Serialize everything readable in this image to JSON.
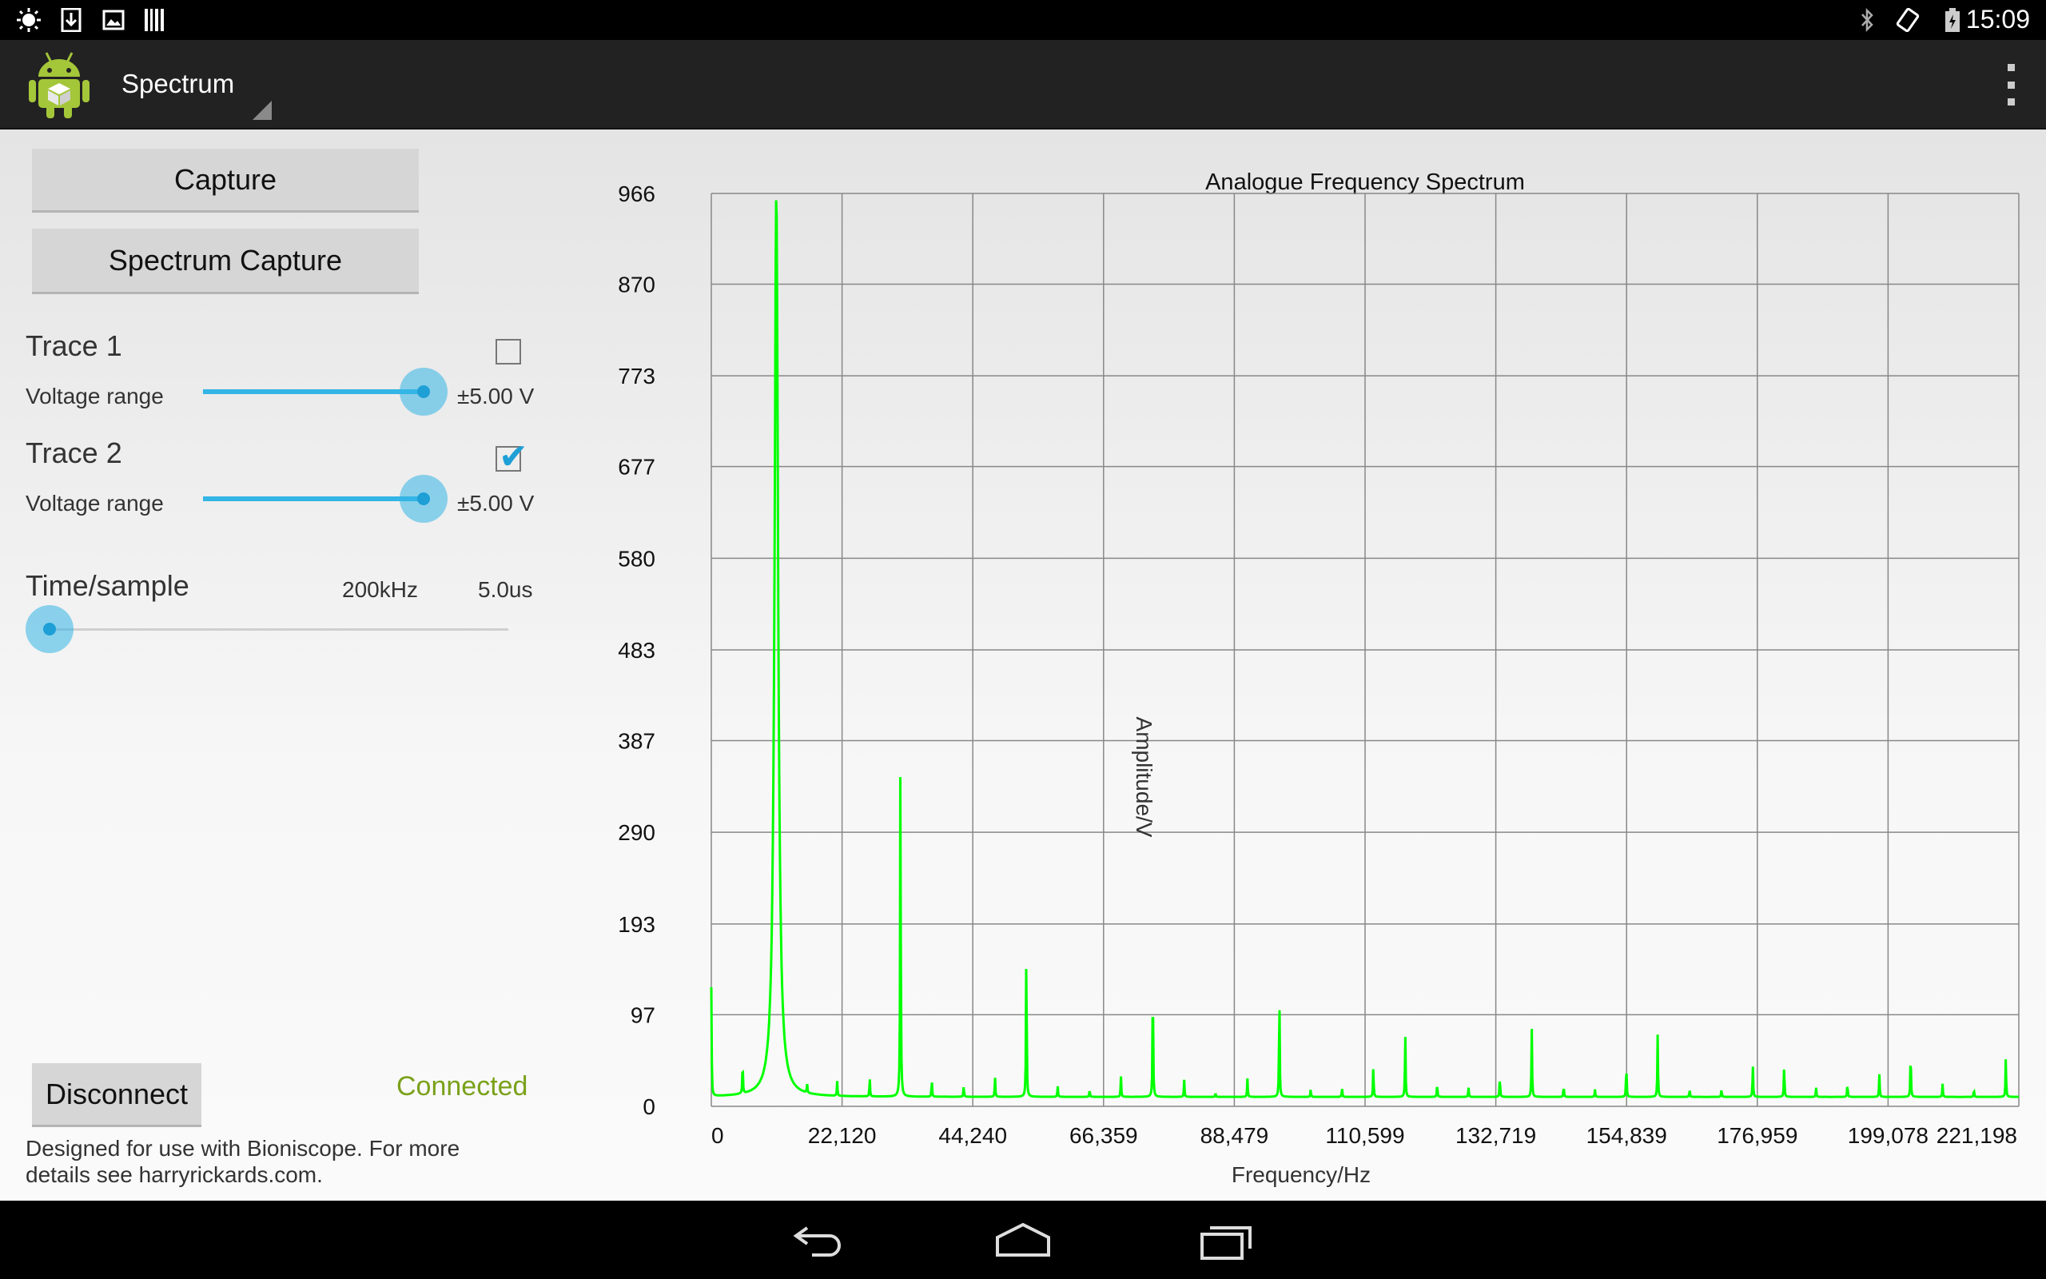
{
  "status_bar": {
    "time": "15:09",
    "left_icons": [
      "brightness-icon",
      "download-icon",
      "image-icon",
      "barcode-icon"
    ],
    "right_icons": [
      "bluetooth-icon",
      "rotation-icon",
      "battery-icon"
    ]
  },
  "action_bar": {
    "title": "Spectrum",
    "app_icon": "android-robot-icon",
    "overflow_icon": "overflow-menu-icon"
  },
  "controls": {
    "capture_label": "Capture",
    "spectrum_capture_label": "Spectrum Capture",
    "trace1": {
      "label": "Trace 1",
      "checked": false,
      "voltage_label": "Voltage range",
      "voltage_value": "±5.00 V",
      "slider_fraction": 1.0
    },
    "trace2": {
      "label": "Trace 2",
      "checked": true,
      "voltage_label": "Voltage range",
      "voltage_value": "±5.00 V",
      "slider_fraction": 1.0
    },
    "time_sample": {
      "label": "Time/sample",
      "rate": "200kHz",
      "period": "5.0us",
      "slider_fraction": 0.0
    },
    "disconnect_label": "Disconnect",
    "connection_status": "Connected",
    "footer": "Designed for use with Bioniscope. For more details see harryrickards.com."
  },
  "colors": {
    "accent": "#33b5e5",
    "trace": "#00ff00",
    "connected": "#7aa11a",
    "action_bar": "#222222"
  },
  "chart_data": {
    "type": "line",
    "title": "Analogue Frequency Spectrum",
    "xlabel": "Frequency/Hz",
    "ylabel": "Amplitude/V",
    "xlim": [
      0,
      221198
    ],
    "ylim": [
      0,
      966
    ],
    "grid": true,
    "x_ticks": [
      0,
      22120,
      44240,
      66359,
      88479,
      110599,
      132719,
      154839,
      176959,
      199078,
      221198
    ],
    "x_tick_labels": [
      "0",
      "22,120",
      "44,240",
      "66,359",
      "88,479",
      "110,599",
      "132,719",
      "154,839",
      "176,959",
      "199,078",
      "221,198"
    ],
    "y_ticks": [
      0,
      97,
      193,
      290,
      387,
      483,
      580,
      677,
      773,
      870,
      966
    ],
    "y_tick_labels": [
      "0",
      "97",
      "193",
      "290",
      "387",
      "483",
      "580",
      "677",
      "773",
      "870",
      "966"
    ],
    "series": [
      {
        "color": "#00ff00",
        "baseline": 10,
        "peaks": [
          {
            "x": 0,
            "y": 125
          },
          {
            "x": 5300,
            "y": 45
          },
          {
            "x": 11000,
            "y": 966
          },
          {
            "x": 16200,
            "y": 20
          },
          {
            "x": 21300,
            "y": 26
          },
          {
            "x": 26800,
            "y": 30
          },
          {
            "x": 32000,
            "y": 380
          },
          {
            "x": 37300,
            "y": 28
          },
          {
            "x": 42700,
            "y": 22
          },
          {
            "x": 48000,
            "y": 32
          },
          {
            "x": 53300,
            "y": 175
          },
          {
            "x": 58600,
            "y": 22
          },
          {
            "x": 64000,
            "y": 18
          },
          {
            "x": 69300,
            "y": 32
          },
          {
            "x": 74700,
            "y": 143
          },
          {
            "x": 80000,
            "y": 28
          },
          {
            "x": 85300,
            "y": 14
          },
          {
            "x": 90700,
            "y": 30
          },
          {
            "x": 96100,
            "y": 123
          },
          {
            "x": 101400,
            "y": 18
          },
          {
            "x": 106700,
            "y": 20
          },
          {
            "x": 112000,
            "y": 42
          },
          {
            "x": 117400,
            "y": 80
          },
          {
            "x": 122800,
            "y": 24
          },
          {
            "x": 128100,
            "y": 20
          },
          {
            "x": 133400,
            "y": 32
          },
          {
            "x": 138800,
            "y": 82
          },
          {
            "x": 144200,
            "y": 22
          },
          {
            "x": 149500,
            "y": 18
          },
          {
            "x": 154800,
            "y": 45
          },
          {
            "x": 160100,
            "y": 77
          },
          {
            "x": 165500,
            "y": 18
          },
          {
            "x": 170900,
            "y": 18
          },
          {
            "x": 176200,
            "y": 46
          },
          {
            "x": 181500,
            "y": 44
          },
          {
            "x": 186900,
            "y": 20
          },
          {
            "x": 192200,
            "y": 24
          },
          {
            "x": 197600,
            "y": 34
          },
          {
            "x": 202900,
            "y": 60
          },
          {
            "x": 208300,
            "y": 24
          },
          {
            "x": 213600,
            "y": 18
          },
          {
            "x": 219000,
            "y": 52
          }
        ]
      }
    ]
  }
}
